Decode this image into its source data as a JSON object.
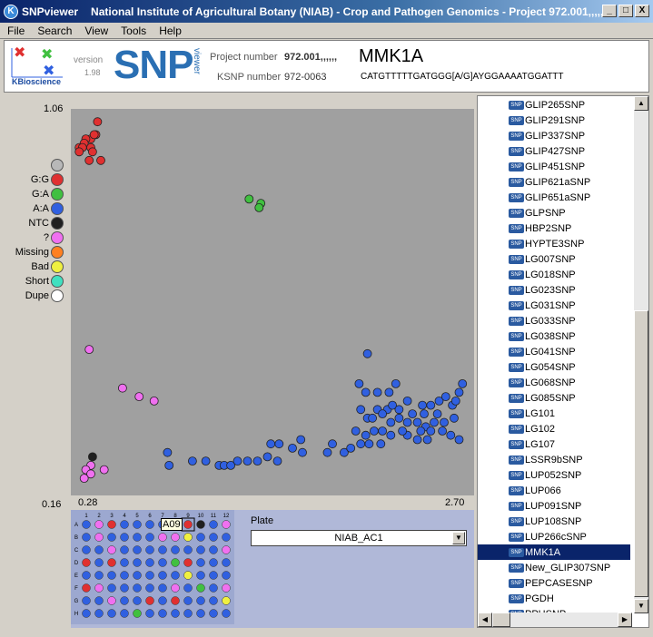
{
  "window": {
    "app_name": "SNPviewer",
    "title": "National Institute of Agricultural Botany (NIAB) - Crop and Pathogen Genomics - Project 972.001,,,,,,...",
    "minimize": "_",
    "maximize": "□",
    "close": "X"
  },
  "menu": [
    "File",
    "Search",
    "View",
    "Tools",
    "Help"
  ],
  "header": {
    "company": "KBioscience",
    "version_label": "version",
    "version": "1.98",
    "logo_text": "SNP",
    "logo_sub": "viewer",
    "project_label": "Project number",
    "project_value": "972.001,,,,,,",
    "ksnp_label": "KSNP number",
    "ksnp_value": "972-0063",
    "snp_name": "MMK1A",
    "sequence": "CATGTTTTTGATGGG[A/G]AYGGAAAATGGATTT"
  },
  "axes": {
    "y_top": "1.06",
    "y_bottom": "0.16",
    "x_left": "0.28",
    "x_right": "2.70"
  },
  "legend": [
    {
      "label": "",
      "color": "#b8b8b8"
    },
    {
      "label": "G:G",
      "color": "#e03030"
    },
    {
      "label": "G:A",
      "color": "#40c040"
    },
    {
      "label": "A:A",
      "color": "#3060e0"
    },
    {
      "label": "NTC",
      "color": "#202020"
    },
    {
      "label": "?",
      "color": "#f070f0"
    },
    {
      "label": "Missing",
      "color": "#ff8020"
    },
    {
      "label": "Bad",
      "color": "#f0f040"
    },
    {
      "label": "Short",
      "color": "#40e0c0"
    },
    {
      "label": "Dupe",
      "color": "#ffffff"
    }
  ],
  "chart_data": {
    "type": "scatter",
    "xlim": [
      0.28,
      2.7
    ],
    "ylim": [
      0.16,
      1.06
    ],
    "series": [
      {
        "name": "G:G",
        "color": "#e03030",
        "points": [
          [
            0.44,
            1.03
          ],
          [
            0.43,
            1.0
          ],
          [
            0.4,
            0.99
          ],
          [
            0.42,
            1.0
          ],
          [
            0.37,
            0.99
          ],
          [
            0.36,
            0.98
          ],
          [
            0.4,
            0.97
          ],
          [
            0.33,
            0.97
          ],
          [
            0.35,
            0.97
          ],
          [
            0.41,
            0.96
          ],
          [
            0.33,
            0.96
          ],
          [
            0.46,
            0.94
          ],
          [
            0.39,
            0.94
          ]
        ]
      },
      {
        "name": "G:A",
        "color": "#40c040",
        "points": [
          [
            1.35,
            0.85
          ],
          [
            1.42,
            0.84
          ],
          [
            1.41,
            0.83
          ]
        ]
      },
      {
        "name": "A:A",
        "color": "#3060e0",
        "points": [
          [
            0.86,
            0.26
          ],
          [
            0.87,
            0.23
          ],
          [
            1.01,
            0.24
          ],
          [
            1.09,
            0.24
          ],
          [
            1.17,
            0.23
          ],
          [
            1.2,
            0.23
          ],
          [
            1.24,
            0.23
          ],
          [
            1.28,
            0.24
          ],
          [
            1.34,
            0.24
          ],
          [
            1.4,
            0.24
          ],
          [
            1.46,
            0.25
          ],
          [
            1.52,
            0.24
          ],
          [
            1.48,
            0.28
          ],
          [
            1.53,
            0.28
          ],
          [
            1.61,
            0.27
          ],
          [
            1.66,
            0.29
          ],
          [
            1.67,
            0.26
          ],
          [
            1.82,
            0.26
          ],
          [
            1.85,
            0.28
          ],
          [
            1.92,
            0.26
          ],
          [
            1.96,
            0.27
          ],
          [
            2.06,
            0.49
          ],
          [
            2.01,
            0.42
          ],
          [
            2.05,
            0.4
          ],
          [
            2.12,
            0.4
          ],
          [
            2.19,
            0.4
          ],
          [
            2.23,
            0.42
          ],
          [
            2.18,
            0.36
          ],
          [
            2.12,
            0.36
          ],
          [
            2.02,
            0.36
          ],
          [
            2.06,
            0.34
          ],
          [
            2.09,
            0.34
          ],
          [
            2.15,
            0.35
          ],
          [
            2.21,
            0.37
          ],
          [
            2.25,
            0.36
          ],
          [
            2.3,
            0.38
          ],
          [
            2.39,
            0.37
          ],
          [
            2.44,
            0.37
          ],
          [
            2.49,
            0.38
          ],
          [
            2.53,
            0.39
          ],
          [
            2.57,
            0.37
          ],
          [
            2.59,
            0.38
          ],
          [
            2.61,
            0.4
          ],
          [
            2.63,
            0.42
          ],
          [
            2.58,
            0.34
          ],
          [
            2.52,
            0.33
          ],
          [
            2.46,
            0.33
          ],
          [
            2.41,
            0.32
          ],
          [
            2.36,
            0.33
          ],
          [
            2.3,
            0.33
          ],
          [
            2.25,
            0.34
          ],
          [
            2.2,
            0.33
          ],
          [
            2.15,
            0.31
          ],
          [
            2.1,
            0.31
          ],
          [
            2.05,
            0.3
          ],
          [
            2.02,
            0.28
          ],
          [
            1.99,
            0.31
          ],
          [
            2.07,
            0.28
          ],
          [
            2.14,
            0.28
          ],
          [
            2.2,
            0.3
          ],
          [
            2.3,
            0.3
          ],
          [
            2.38,
            0.31
          ],
          [
            2.44,
            0.31
          ],
          [
            2.51,
            0.31
          ],
          [
            2.56,
            0.3
          ],
          [
            2.61,
            0.29
          ],
          [
            2.48,
            0.35
          ],
          [
            2.4,
            0.35
          ],
          [
            2.33,
            0.35
          ],
          [
            2.27,
            0.31
          ],
          [
            2.36,
            0.29
          ],
          [
            2.42,
            0.29
          ]
        ]
      },
      {
        "name": "NTC",
        "color": "#202020",
        "points": [
          [
            0.41,
            0.25
          ]
        ]
      },
      {
        "name": "?",
        "color": "#f070f0",
        "points": [
          [
            0.39,
            0.5
          ],
          [
            0.59,
            0.41
          ],
          [
            0.69,
            0.39
          ],
          [
            0.78,
            0.38
          ],
          [
            0.4,
            0.23
          ],
          [
            0.37,
            0.22
          ],
          [
            0.4,
            0.21
          ],
          [
            0.48,
            0.22
          ],
          [
            0.36,
            0.2
          ]
        ]
      }
    ]
  },
  "plate": {
    "label": "Plate",
    "selected": "NIAB_AC1",
    "columns": [
      "1",
      "2",
      "3",
      "4",
      "5",
      "6",
      "7",
      "8",
      "9",
      "10",
      "11",
      "12"
    ],
    "rows": [
      "A",
      "B",
      "C",
      "D",
      "E",
      "F",
      "G",
      "H"
    ],
    "tooltip": "A09",
    "wells": [
      [
        "b",
        "p",
        "r",
        "b",
        "b",
        "b",
        "b",
        "b",
        "r",
        "k",
        "b",
        "p"
      ],
      [
        "b",
        "p",
        "b",
        "b",
        "b",
        "b",
        "p",
        "p",
        "y",
        "b",
        "b",
        "b"
      ],
      [
        "b",
        "b",
        "p",
        "b",
        "b",
        "b",
        "b",
        "b",
        "b",
        "b",
        "b",
        "p"
      ],
      [
        "r",
        "b",
        "r",
        "b",
        "b",
        "b",
        "b",
        "g",
        "r",
        "b",
        "b",
        "b"
      ],
      [
        "b",
        "b",
        "b",
        "b",
        "b",
        "b",
        "b",
        "b",
        "y",
        "b",
        "b",
        "b"
      ],
      [
        "r",
        "p",
        "b",
        "b",
        "b",
        "b",
        "b",
        "p",
        "b",
        "g",
        "b",
        "p"
      ],
      [
        "b",
        "b",
        "p",
        "b",
        "b",
        "r",
        "b",
        "r",
        "b",
        "b",
        "b",
        "y"
      ],
      [
        "b",
        "b",
        "b",
        "b",
        "g",
        "b",
        "b",
        "b",
        "b",
        "b",
        "b",
        "b"
      ]
    ]
  },
  "list": {
    "items": [
      "GLIP265SNP",
      "GLIP291SNP",
      "GLIP337SNP",
      "GLIP427SNP",
      "GLIP451SNP",
      "GLIP621aSNP",
      "GLIP651aSNP",
      "GLPSNP",
      "HBP2SNP",
      "HYPTE3SNP",
      "LG007SNP",
      "LG018SNP",
      "LG023SNP",
      "LG031SNP",
      "LG033SNP",
      "LG038SNP",
      "LG041SNP",
      "LG054SNP",
      "LG068SNP",
      "LG085SNP",
      "LG101",
      "LG102",
      "LG107",
      "LSSR9bSNP",
      "LUP052SNP",
      "LUP066",
      "LUP091SNP",
      "LUP108SNP",
      "LUP266cSNP",
      "MMK1A",
      "New_GLIP307SNP",
      "PEPCASESNP",
      "PGDH",
      "PPHSNP"
    ],
    "selected_index": 29,
    "icon_text": "SNP"
  }
}
